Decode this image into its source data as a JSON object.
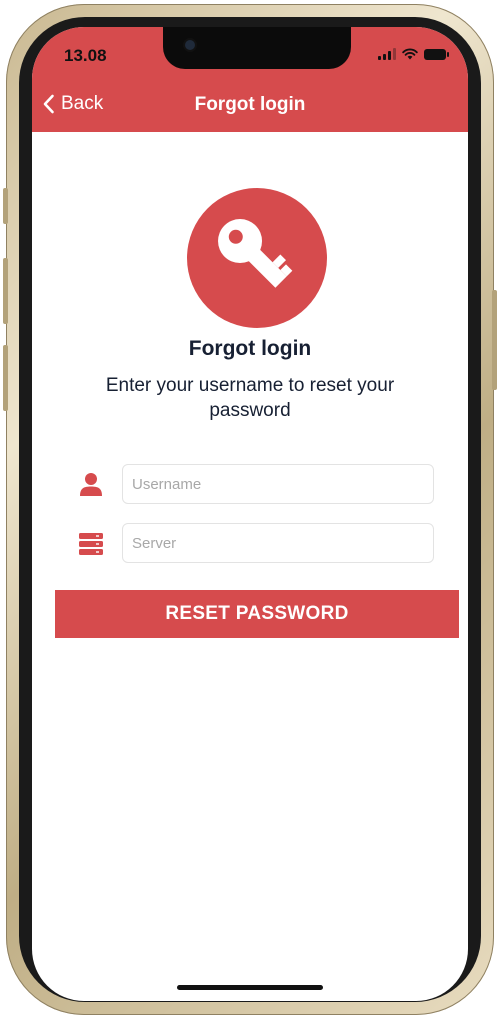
{
  "status_bar": {
    "time": "13.08",
    "icons": [
      "signal-icon",
      "wifi-icon",
      "battery-icon"
    ]
  },
  "nav": {
    "back_label": "Back",
    "back_icon": "chevron-left-icon",
    "title": "Forgot login"
  },
  "hero": {
    "icon": "key-icon",
    "title": "Forgot login",
    "subtitle": "Enter your username to reset your password"
  },
  "form": {
    "username": {
      "icon": "user-icon",
      "placeholder": "Username",
      "value": ""
    },
    "server": {
      "icon": "server-icon",
      "placeholder": "Server",
      "value": ""
    },
    "submit_label": "RESET PASSWORD"
  },
  "colors": {
    "accent": "#d64b4d",
    "text_dark": "#172033",
    "placeholder": "#a8a8a8"
  }
}
